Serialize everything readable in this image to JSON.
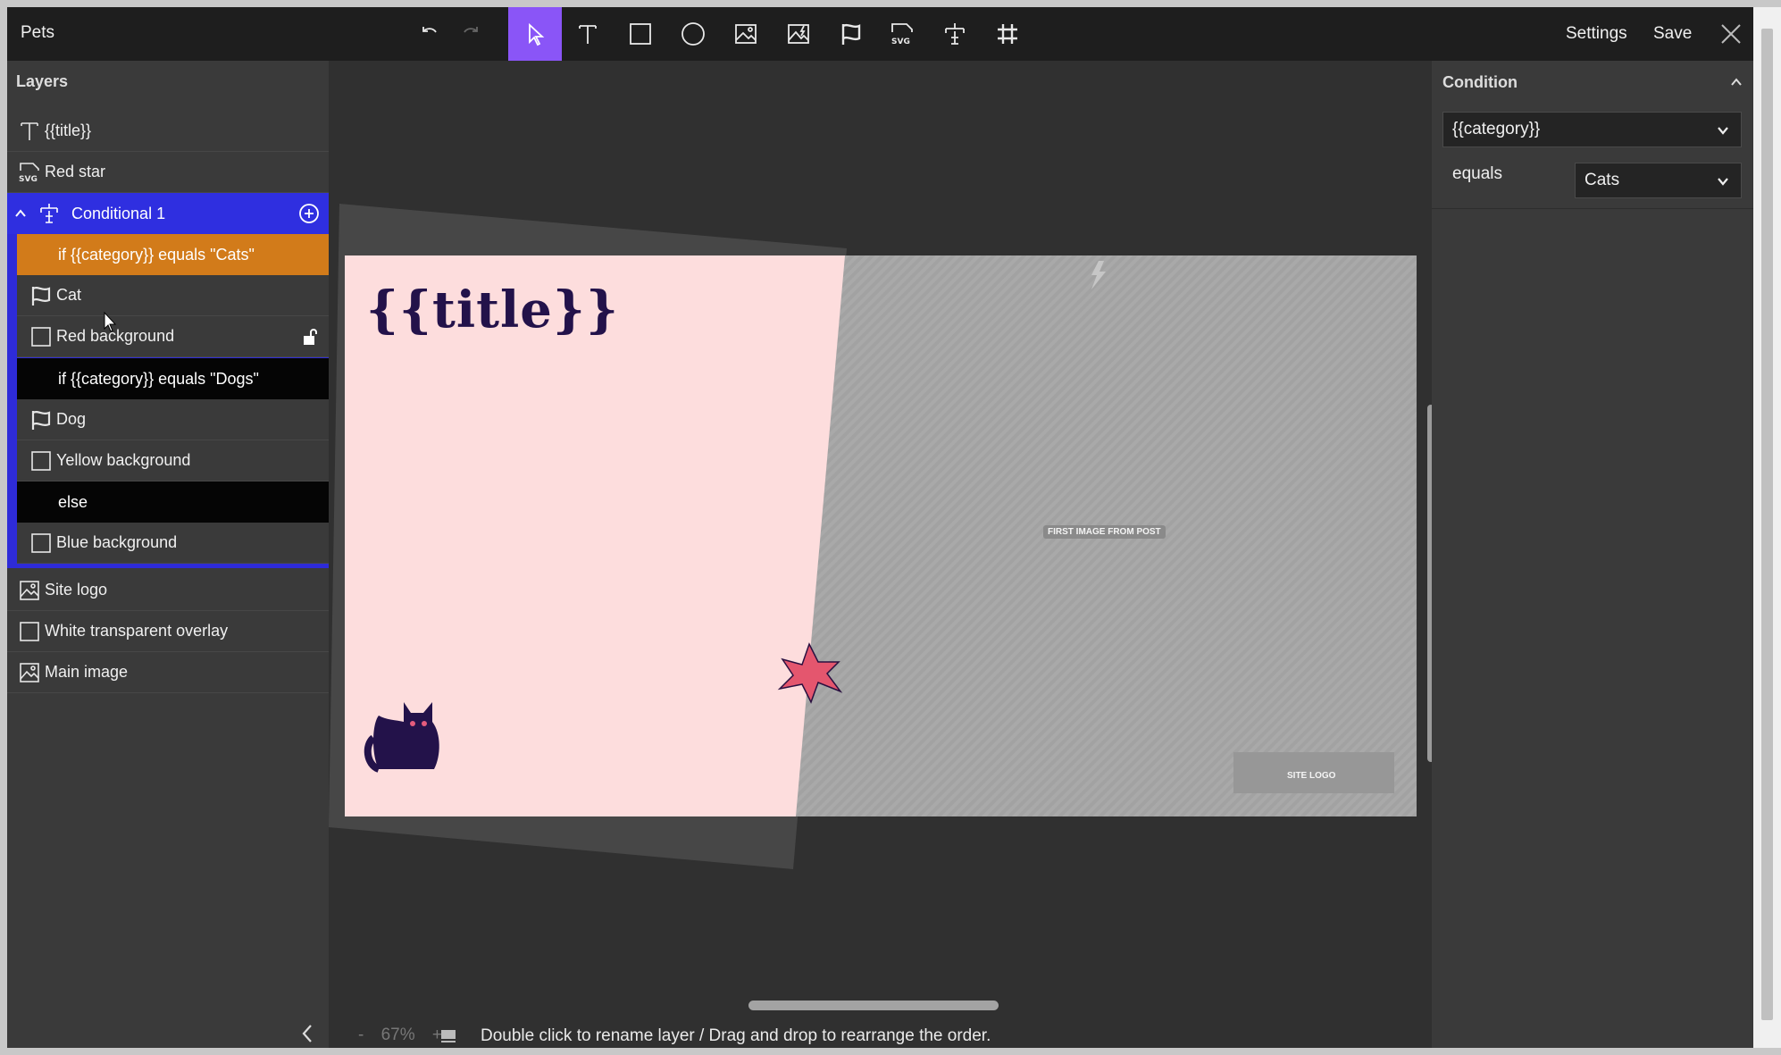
{
  "app": {
    "title": "Pets"
  },
  "toolbar": {
    "tools": [
      "undo-icon",
      "redo-icon",
      "select-pointer-icon",
      "text-tool-icon",
      "rectangle-tool-icon",
      "ellipse-tool-icon",
      "image-tool-icon",
      "dynamic-image-tool-icon",
      "flag-tool-icon",
      "svg-tool-icon",
      "conditional-tool-icon",
      "grid-icon"
    ],
    "svg_tool_text": "SVG",
    "active_tool": "select-pointer-icon",
    "accent_color": "#8a55f7",
    "settings_label": "Settings",
    "save_label": "Save"
  },
  "layers": {
    "heading": "Layers",
    "top_items": [
      {
        "label": "{{title}}",
        "icon": "text-layer-icon"
      },
      {
        "label": "Red star",
        "icon": "svg-layer-icon"
      }
    ],
    "svg_icon_text": "SVG",
    "conditional": {
      "label": "Conditional 1",
      "color": "#2f2fe0",
      "branches": [
        {
          "label": "if {{category}} equals \"Cats\"",
          "color": "#d27b1a"
        },
        {
          "label": "if {{category}} equals \"Dogs\"",
          "color": "#050505"
        },
        {
          "label": "else",
          "color": "#050505"
        }
      ],
      "children": [
        {
          "label": "Cat",
          "icon": "flag-layer-icon"
        },
        {
          "label": "Red background",
          "icon": "rectangle-layer-icon"
        },
        {
          "label": "Dog",
          "icon": "flag-layer-icon"
        },
        {
          "label": "Yellow background",
          "icon": "rectangle-layer-icon"
        },
        {
          "label": "Blue background",
          "icon": "rectangle-layer-icon"
        }
      ]
    },
    "bottom_items": [
      {
        "label": "Site logo",
        "icon": "image-layer-icon"
      },
      {
        "label": "White transparent overlay",
        "icon": "rectangle-layer-icon"
      },
      {
        "label": "Main image",
        "icon": "image-layer-icon"
      }
    ]
  },
  "canvas": {
    "title_text": "{{title}}",
    "title_color": "#23124a",
    "pink_color": "#fddddd",
    "image_placeholder": "FIRST IMAGE FROM POST",
    "logo_placeholder": "SITE LOGO",
    "zoom": "67%",
    "zoom_minus": "-",
    "zoom_plus": "+",
    "hint": "Double click to rename layer / Drag and drop to rearrange the order."
  },
  "condition_panel": {
    "heading": "Condition",
    "field_value": "{{category}}",
    "operator_label": "equals",
    "operand_value": "Cats"
  }
}
